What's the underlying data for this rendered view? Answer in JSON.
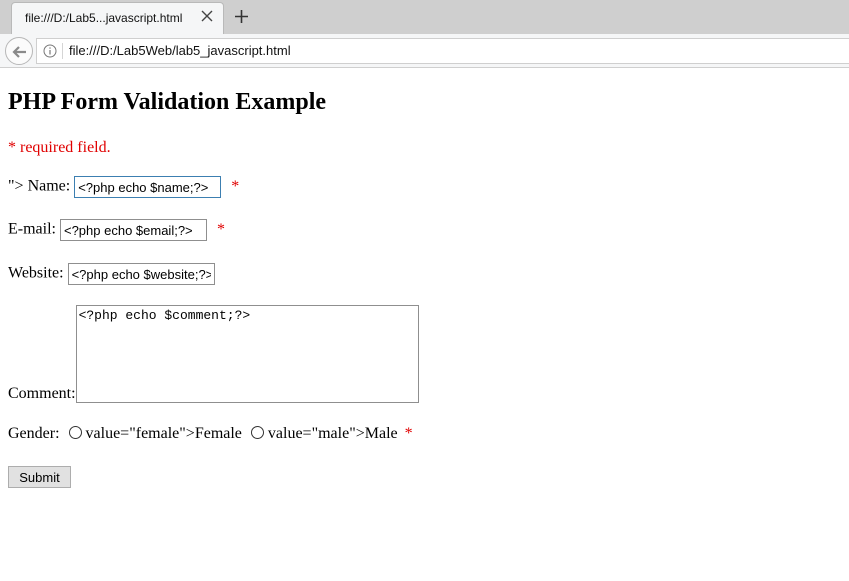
{
  "browser": {
    "tab_title": "file:///D:/Lab5...javascript.html",
    "url": "file:///D:/Lab5Web/lab5_javascript.html"
  },
  "page": {
    "heading": "PHP Form Validation Example",
    "required_note": "* required field.",
    "name_label_prefix": "\">",
    "name_label": "Name:",
    "name_value": "<?php echo $name;?>",
    "email_label": "E-mail:",
    "email_value": "<?php echo $email;?>",
    "website_label": "Website:",
    "website_value": "<?php echo $website;?>",
    "comment_label": "Comment:",
    "comment_value": "<?php echo $comment;?>",
    "gender_label": "Gender:",
    "female_label": "value=\"female\">Female",
    "male_label": "value=\"male\">Male",
    "required_star": "*",
    "submit_label": "Submit"
  },
  "colors": {
    "required": "#e00000",
    "focus_border": "#3c7fb1"
  }
}
